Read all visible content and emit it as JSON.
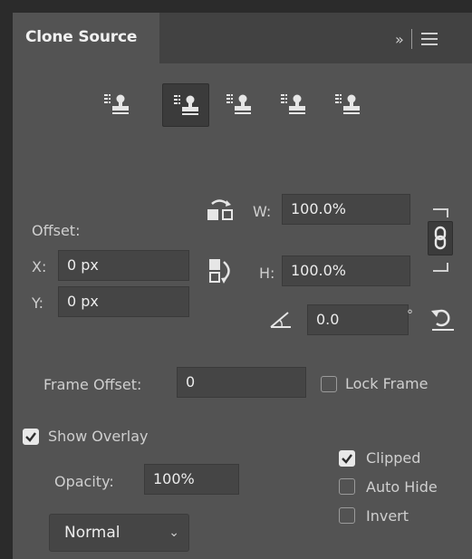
{
  "panel": {
    "tab_title": "Clone Source",
    "collapse_glyph": "»",
    "menu_icon": "hamburger-icon"
  },
  "sources": [
    {
      "name": "clone-source-1",
      "active": false
    },
    {
      "name": "clone-source-2",
      "active": true
    },
    {
      "name": "clone-source-3",
      "active": false
    },
    {
      "name": "clone-source-4",
      "active": false
    },
    {
      "name": "clone-source-5",
      "active": false
    }
  ],
  "offset": {
    "label": "Offset:",
    "x_label": "X:",
    "x_value": "0 px",
    "y_label": "Y:",
    "y_value": "0 px"
  },
  "scale": {
    "w_label": "W:",
    "w_value": "100.0%",
    "h_label": "H:",
    "h_value": "100.0%",
    "link_icon": "chain-link-icon"
  },
  "rotation": {
    "value": "0.0",
    "degree_symbol": "°",
    "reset_icon": "reset-transform-icon"
  },
  "frame": {
    "label": "Frame Offset:",
    "value": "0",
    "lock_label": "Lock Frame",
    "lock_checked": false
  },
  "overlay": {
    "show_label": "Show Overlay",
    "show_checked": true,
    "opacity_label": "Opacity:",
    "opacity_value": "100%",
    "clipped_label": "Clipped",
    "clipped_checked": true,
    "auto_hide_label": "Auto Hide",
    "auto_hide_checked": false,
    "invert_label": "Invert",
    "invert_checked": false,
    "blend_mode": "Normal"
  }
}
